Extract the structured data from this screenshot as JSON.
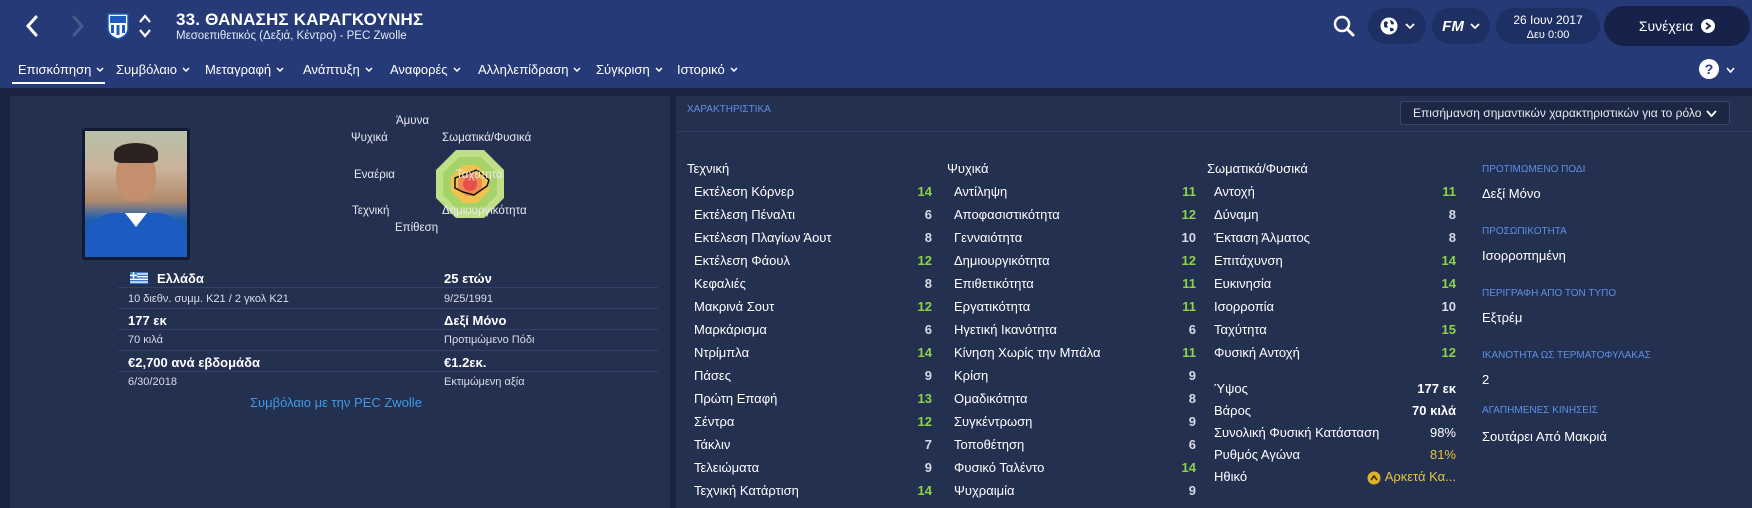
{
  "header": {
    "title": "33. ΘΑΝΑΣΗΣ ΚΑΡΑΓΚΟΥΝΗΣ",
    "subtitle": "Μεσοεπιθετικός (Δεξιά, Κέντρο) - PEC Zwolle",
    "date": "26 Ιουν 2017",
    "day_time": "Δευ 0:00",
    "continue_label": "Συνέχεια",
    "fm_label": "FM",
    "help_label": "?"
  },
  "tabs": [
    {
      "label": "Επισκόπηση"
    },
    {
      "label": "Συμβόλαιο"
    },
    {
      "label": "Μεταγραφή"
    },
    {
      "label": "Ανάπτυξη"
    },
    {
      "label": "Αναφορές"
    },
    {
      "label": "Αλληλεπίδραση"
    },
    {
      "label": "Σύγκριση"
    },
    {
      "label": "Ιστορικό"
    }
  ],
  "radar": {
    "labels": {
      "top": "Άμυνα",
      "top_right": "Σωματικά/Φυσικά",
      "right": "Ταχύτητα",
      "bottom_right": "Δημιουργικότητα",
      "bottom": "Επίθεση",
      "bottom_left": "Τεχνική",
      "left": "Εναέρια",
      "top_left": "Ψυχικά"
    }
  },
  "profile": {
    "nationality": "Ελλάδα",
    "caps": "10 διεθν. συμμ. Κ21 / 2 γκολ Κ21",
    "height": "177 εκ",
    "weight": "70 κιλά",
    "wage": "€2,700 ανά εβδομάδα",
    "contract_end": "6/30/2018",
    "age": "25 ετών",
    "dob": "9/25/1991",
    "foot": "Δεξί Μόνο",
    "foot_label": "Προτιμώμενο Πόδι",
    "value": "€1.2εκ.",
    "value_label": "Εκτιμώμενη αξία",
    "contract_link": "Συμβόλαιο με την PEC Zwolle"
  },
  "attributes": {
    "header": "ΧΑΡΑΚΤΗΡΙΣΤΙΚΑ",
    "highlight_dropdown": "Επισήμανση σημαντικών χαρακτηριστικών για το ρόλο",
    "technical_title": "Τεχνική",
    "mental_title": "Ψυχικά",
    "physical_title": "Σωματικά/Φυσικά",
    "technical": [
      {
        "name": "Εκτέλεση Κόρνερ",
        "value": "14"
      },
      {
        "name": "Εκτέλεση Πέναλτι",
        "value": "6"
      },
      {
        "name": "Εκτέλεση Πλαγίων Άουτ",
        "value": "8"
      },
      {
        "name": "Εκτέλεση Φάουλ",
        "value": "12"
      },
      {
        "name": "Κεφαλιές",
        "value": "8"
      },
      {
        "name": "Μακρινά Σουτ",
        "value": "12"
      },
      {
        "name": "Μαρκάρισμα",
        "value": "6"
      },
      {
        "name": "Ντρίμπλα",
        "value": "14"
      },
      {
        "name": "Πάσες",
        "value": "9"
      },
      {
        "name": "Πρώτη Επαφή",
        "value": "13"
      },
      {
        "name": "Σέντρα",
        "value": "12"
      },
      {
        "name": "Τάκλιν",
        "value": "7"
      },
      {
        "name": "Τελειώματα",
        "value": "9"
      },
      {
        "name": "Τεχνική Κατάρτιση",
        "value": "14"
      }
    ],
    "mental": [
      {
        "name": "Αντίληψη",
        "value": "11"
      },
      {
        "name": "Αποφασιστικότητα",
        "value": "12"
      },
      {
        "name": "Γενναιότητα",
        "value": "10"
      },
      {
        "name": "Δημιουργικότητα",
        "value": "12"
      },
      {
        "name": "Επιθετικότητα",
        "value": "11"
      },
      {
        "name": "Εργατικότητα",
        "value": "11"
      },
      {
        "name": "Ηγετική Ικανότητα",
        "value": "6"
      },
      {
        "name": "Κίνηση Χωρίς την Μπάλα",
        "value": "11"
      },
      {
        "name": "Κρίση",
        "value": "9"
      },
      {
        "name": "Ομαδικότητα",
        "value": "8"
      },
      {
        "name": "Συγκέντρωση",
        "value": "9"
      },
      {
        "name": "Τοποθέτηση",
        "value": "6"
      },
      {
        "name": "Φυσικό Ταλέντο",
        "value": "14"
      },
      {
        "name": "Ψυχραιμία",
        "value": "9"
      }
    ],
    "physical": [
      {
        "name": "Αντοχή",
        "value": "11"
      },
      {
        "name": "Δύναμη",
        "value": "8"
      },
      {
        "name": "Έκταση Άλματος",
        "value": "8"
      },
      {
        "name": "Επιτάχυνση",
        "value": "14"
      },
      {
        "name": "Ευκινησία",
        "value": "14"
      },
      {
        "name": "Ισορροπία",
        "value": "10"
      },
      {
        "name": "Ταχύτητα",
        "value": "15"
      },
      {
        "name": "Φυσική Αντοχή",
        "value": "12"
      }
    ],
    "extra": [
      {
        "name": "Ύψος",
        "value": "177 εκ"
      },
      {
        "name": "Βάρος",
        "value": "70 κιλά"
      },
      {
        "name": "Συνολική Φυσική Κατάσταση",
        "value": "98%"
      },
      {
        "name": "Ρυθμός Αγώνα",
        "value": "81%"
      },
      {
        "name": "Ηθικό",
        "value": "Αρκετά Κα..."
      }
    ]
  },
  "side_info": {
    "foot_head": "ΠΡΟΤΙΜΩΜΕΝΟ ΠΟΔΙ",
    "foot_val": "Δεξί Μόνο",
    "personality_head": "ΠΡΟΣΩΠΙΚΟΤΗΤΑ",
    "personality_val": "Ισορροπημένη",
    "media_head": "ΠΕΡΙΓΡΑΦΗ ΑΠΟ ΤΟΝ ΤΥΠΟ",
    "media_val": "Εξτρέμ",
    "gk_head": "ΙΚΑΝΟΤΗΤΑ ΩΣ ΤΕΡΜΑΤΟΦΥΛΑΚΑΣ",
    "gk_val": "2",
    "moves_head": "ΑΓΑΠΗΜΕΝΕΣ ΚΙΝΗΣΕΙΣ",
    "moves_val": "Σουτάρει Από Μακριά"
  },
  "colors": {
    "header_bg": "#263a78",
    "panel_bg": "#243050",
    "high_value": "#8cd24a",
    "mid_value": "#e0c53a",
    "link": "#3d9be6"
  }
}
